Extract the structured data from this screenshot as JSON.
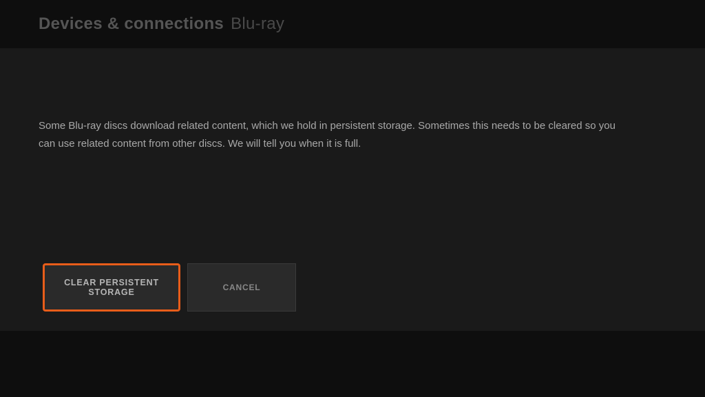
{
  "header": {
    "title": "Devices & connections",
    "subtitle": "Blu-ray"
  },
  "content": {
    "description": "Some Blu-ray discs download related content, which we hold in persistent storage.  Sometimes this needs to be cleared so you can use related content from other discs. We will tell you when it is full."
  },
  "buttons": {
    "primary": "CLEAR PERSISTENT STORAGE",
    "secondary": "CANCEL"
  }
}
